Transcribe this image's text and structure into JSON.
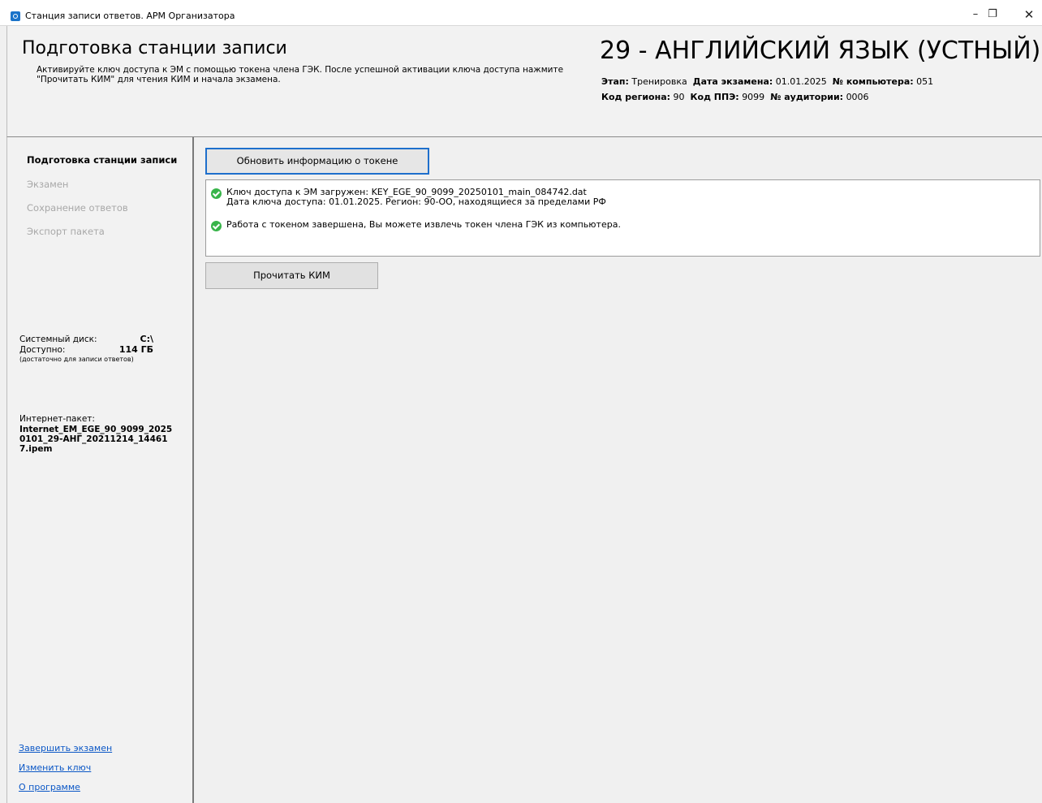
{
  "window": {
    "title": "Станция записи ответов. АРМ Организатора",
    "minimize": "–",
    "restore": "❐",
    "close": "✕"
  },
  "header": {
    "title": "Подготовка станции записи",
    "description": "Активируйте ключ доступа к ЭМ с помощью токена члена ГЭК. После успешной активации ключа доступа нажмите \"Прочитать КИМ\" для чтения КИМ и начала экзамена.",
    "subject": "29 - АНГЛИЙСКИЙ ЯЗЫК (УСТНЫЙ)",
    "stage_label": "Этап:",
    "stage_value": "Тренировка",
    "exam_date_label": "Дата экзамена:",
    "exam_date_value": "01.01.2025",
    "computer_label": "№ компьютера:",
    "computer_value": "051",
    "region_label": "Код региона:",
    "region_value": "90",
    "ppe_label": "Код ППЭ:",
    "ppe_value": "9099",
    "room_label": "№ аудитории:",
    "room_value": "0006"
  },
  "sidebar": {
    "nav": [
      {
        "label": "Подготовка станции записи",
        "active": true
      },
      {
        "label": "Экзамен",
        "active": false
      },
      {
        "label": "Сохранение ответов",
        "active": false
      },
      {
        "label": "Экспорт пакета",
        "active": false
      }
    ],
    "disk_label": "Системный диск:",
    "disk_value": "C:\\",
    "available_label": "Доступно:",
    "available_value": "114 ГБ",
    "available_note": "(достаточно для записи ответов)",
    "package_label": "Интернет-пакет:",
    "package_name": "Internet_EM_EGE_90_9099_20250101_29-АНГ_20211214_144617.ipem",
    "links": {
      "finish_exam": "Завершить экзамен",
      "change_key": "Изменить ключ",
      "about": "О программе"
    }
  },
  "main": {
    "refresh_button": "Обновить информацию о токене",
    "log": [
      {
        "icon": "check-circle-icon",
        "line1": "Ключ доступа к ЭМ загружен: KEY_EGE_90_9099_20250101_main_084742.dat",
        "line2": "Дата ключа доступа: 01.01.2025. Регион: 90-ОО, находящиеся за пределами РФ"
      },
      {
        "icon": "check-circle-icon",
        "line1": "Работа с токеном завершена, Вы можете извлечь токен члена ГЭК из компьютера."
      }
    ],
    "read_kim_button": "Прочитать КИМ"
  },
  "colors": {
    "accent_border": "#1e6fcc",
    "success": "#38b44a",
    "link": "#0b57c6"
  }
}
